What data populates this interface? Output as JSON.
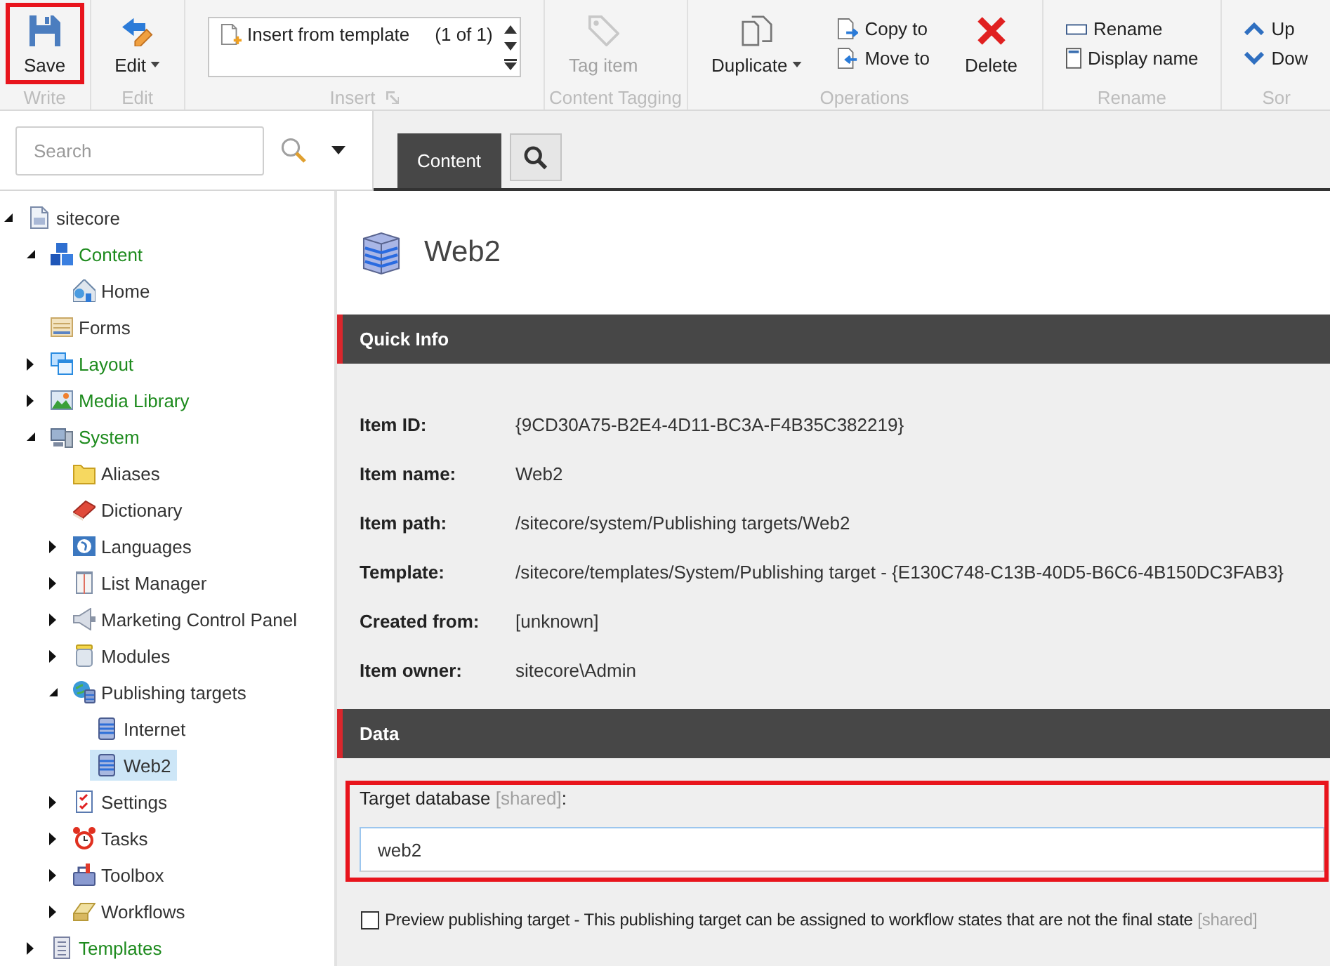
{
  "ribbon": {
    "groups": [
      {
        "label": "Write",
        "launcher": false,
        "buttons": [
          {
            "kind": "large",
            "label": "Save",
            "dropdown": false,
            "disabled": false,
            "highlighted": true
          }
        ]
      },
      {
        "label": "Edit",
        "launcher": false,
        "buttons": [
          {
            "kind": "large",
            "label": "Edit",
            "dropdown": true,
            "disabled": false,
            "highlighted": false
          }
        ]
      },
      {
        "label": "Insert",
        "launcher": true,
        "buttons": [
          {
            "kind": "gallery",
            "label": "Insert from template",
            "count": "(1 of 1)",
            "dropdown": false,
            "disabled": false,
            "highlighted": false
          }
        ]
      },
      {
        "label": "Content Tagging",
        "launcher": false,
        "buttons": [
          {
            "kind": "large",
            "label": "Tag item",
            "dropdown": false,
            "disabled": true,
            "highlighted": false
          }
        ]
      },
      {
        "label": "Operations",
        "launcher": false,
        "buttons": [
          {
            "kind": "large",
            "label": "Duplicate",
            "dropdown": true,
            "disabled": false,
            "highlighted": false
          },
          {
            "kind": "small",
            "label": "Copy to",
            "dropdown": false,
            "disabled": false,
            "highlighted": false
          },
          {
            "kind": "small",
            "label": "Move to",
            "dropdown": false,
            "disabled": false,
            "highlighted": false
          },
          {
            "kind": "large",
            "label": "Delete",
            "dropdown": false,
            "disabled": false,
            "highlighted": false
          }
        ]
      },
      {
        "label": "Rename",
        "launcher": false,
        "buttons": [
          {
            "kind": "small",
            "label": "Rename",
            "dropdown": false,
            "disabled": false,
            "highlighted": false
          },
          {
            "kind": "small",
            "label": "Display name",
            "dropdown": false,
            "disabled": false,
            "highlighted": false
          }
        ]
      },
      {
        "label": "Sor",
        "launcher": false,
        "buttons": [
          {
            "kind": "small",
            "label": "Up",
            "dropdown": false,
            "disabled": false,
            "highlighted": false
          },
          {
            "kind": "small",
            "label": "Dow",
            "dropdown": false,
            "disabled": false,
            "highlighted": false
          }
        ]
      }
    ]
  },
  "tree_search": {
    "placeholder": "Search"
  },
  "editor_tabs": [
    {
      "kind": "text",
      "label": "Content",
      "selected": true
    },
    {
      "kind": "search",
      "selected": false
    }
  ],
  "tree": [
    {
      "label": "sitecore",
      "expanded": true,
      "selected": false,
      "color": "#333333",
      "children": [
        {
          "label": "Content",
          "expanded": true,
          "selected": false,
          "color": "#1e8b1e",
          "children": [
            {
              "label": "Home",
              "selected": false,
              "color": "#333333"
            }
          ]
        },
        {
          "label": "Forms",
          "selected": false,
          "color": "#333333"
        },
        {
          "label": "Layout",
          "expanded": false,
          "selected": false,
          "color": "#1e8b1e"
        },
        {
          "label": "Media Library",
          "expanded": false,
          "selected": false,
          "color": "#1e8b1e"
        },
        {
          "label": "System",
          "expanded": true,
          "selected": false,
          "color": "#1e8b1e",
          "children": [
            {
              "label": "Aliases",
              "selected": false,
              "color": "#333333"
            },
            {
              "label": "Dictionary",
              "selected": false,
              "color": "#333333"
            },
            {
              "label": "Languages",
              "expanded": false,
              "selected": false,
              "color": "#333333"
            },
            {
              "label": "List Manager",
              "expanded": false,
              "selected": false,
              "color": "#333333"
            },
            {
              "label": "Marketing Control Panel",
              "expanded": false,
              "selected": false,
              "color": "#333333"
            },
            {
              "label": "Modules",
              "expanded": false,
              "selected": false,
              "color": "#333333"
            },
            {
              "label": "Publishing targets",
              "expanded": true,
              "selected": false,
              "color": "#333333",
              "children": [
                {
                  "label": "Internet",
                  "selected": false,
                  "color": "#333333"
                },
                {
                  "label": "Web2",
                  "selected": true,
                  "color": "#333333"
                }
              ]
            },
            {
              "label": "Settings",
              "expanded": false,
              "selected": false,
              "color": "#333333"
            },
            {
              "label": "Tasks",
              "expanded": false,
              "selected": false,
              "color": "#333333"
            },
            {
              "label": "Toolbox",
              "expanded": false,
              "selected": false,
              "color": "#333333"
            },
            {
              "label": "Workflows",
              "expanded": false,
              "selected": false,
              "color": "#333333"
            }
          ]
        },
        {
          "label": "Templates",
          "expanded": false,
          "selected": false,
          "color": "#1e8b1e"
        }
      ]
    }
  ],
  "item": {
    "title": "Web2"
  },
  "sections": [
    {
      "title": "Quick Info",
      "fields": [
        {
          "kind": "info",
          "label": "Item ID:",
          "value": "{9CD30A75-B2E4-4D11-BC3A-F4B35C382219}"
        },
        {
          "kind": "info",
          "label": "Item name:",
          "value": "Web2"
        },
        {
          "kind": "info",
          "label": "Item path:",
          "value": "/sitecore/system/Publishing targets/Web2"
        },
        {
          "kind": "info",
          "label": "Template:",
          "value": "/sitecore/templates/System/Publishing target - {E130C748-C13B-40D5-B6C6-4B150DC3FAB3}"
        },
        {
          "kind": "info",
          "label": "Created from:",
          "value": "[unknown]"
        },
        {
          "kind": "info",
          "label": "Item owner:",
          "value": "sitecore\\Admin"
        }
      ]
    },
    {
      "title": "Data",
      "fields": [
        {
          "kind": "text",
          "label": "Target database",
          "note": "[shared]",
          "suffix": ":",
          "value": "web2",
          "highlighted": true
        },
        {
          "kind": "checkbox",
          "label": "Preview publishing target - This publishing target can be assigned to workflow states that are not the final state",
          "note": "[shared]",
          "checked": false,
          "highlighted": false
        }
      ]
    }
  ]
}
